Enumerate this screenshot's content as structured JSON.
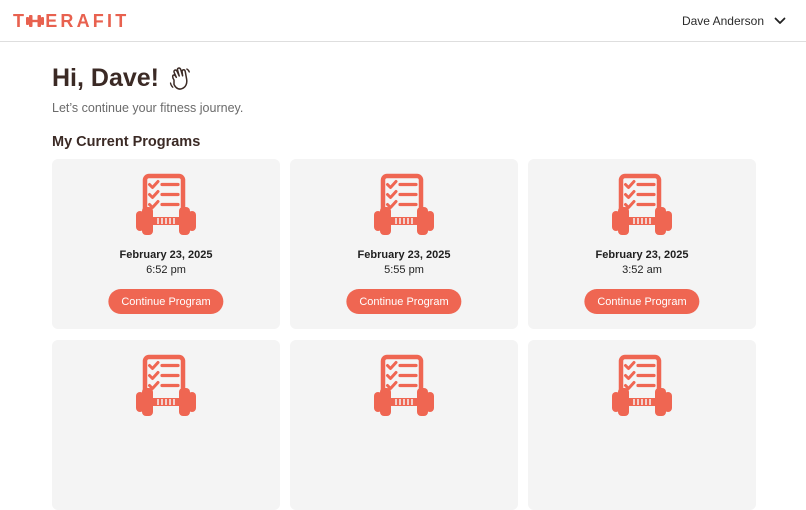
{
  "header": {
    "logo": {
      "prefix": "T",
      "suffix": "ERAFIT",
      "icon": "dumbbell-icon",
      "color": "#e8614f"
    },
    "user": {
      "name": "Dave Anderson",
      "icon": "chevron-down-icon"
    }
  },
  "main": {
    "greeting": "Hi, Dave!",
    "greeting_icon": "waving-hand-icon",
    "subtitle": "Let’s continue your fitness journey.",
    "section_title": "My Current Programs"
  },
  "programs": [
    {
      "date": "February 23, 2025",
      "time": "6:52 pm",
      "button": "Continue Program",
      "icon": "program-checklist-dumbbell-icon"
    },
    {
      "date": "February 23, 2025",
      "time": "5:55 pm",
      "button": "Continue Program",
      "icon": "program-checklist-dumbbell-icon"
    },
    {
      "date": "February 23, 2025",
      "time": "3:52 am",
      "button": "Continue Program",
      "icon": "program-checklist-dumbbell-icon"
    },
    {
      "date": "",
      "time": "",
      "button": "",
      "icon": "program-checklist-dumbbell-icon"
    },
    {
      "date": "",
      "time": "",
      "button": "",
      "icon": "program-checklist-dumbbell-icon"
    },
    {
      "date": "",
      "time": "",
      "button": "",
      "icon": "program-checklist-dumbbell-icon"
    }
  ],
  "colors": {
    "accent": "#ef6652",
    "card_bg": "#f4f4f4",
    "heading": "#3b2a25"
  }
}
